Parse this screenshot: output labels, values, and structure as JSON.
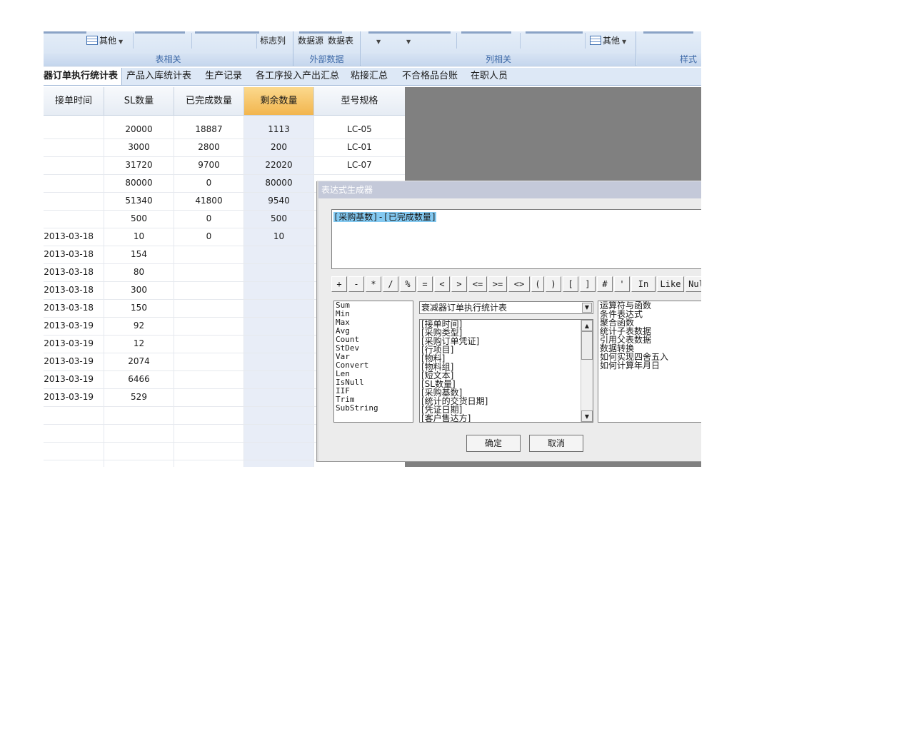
{
  "ribbon": {
    "groups": [
      {
        "title": "表相关",
        "buttons": [
          {
            "label": "其他",
            "icon": "table-icon"
          },
          {
            "label": "标志列"
          }
        ]
      },
      {
        "title": "外部数据",
        "buttons": [
          {
            "label": "数据源"
          },
          {
            "label": "数据表"
          }
        ]
      },
      {
        "title": "列相关",
        "buttons": [
          {
            "label": "其他",
            "icon": "table-icon"
          }
        ]
      },
      {
        "title": "样式"
      }
    ]
  },
  "tabs": [
    "器订单执行统计表",
    "产品入库统计表",
    "生产记录",
    "各工序投入产出汇总",
    "粘接汇总",
    "不合格品台账",
    "在职人员"
  ],
  "grid": {
    "columns": [
      "接单时间",
      "SL数量",
      "已完成数量",
      "剩余数量",
      "型号规格"
    ],
    "selected_column": "剩余数量",
    "rows": [
      [
        "",
        "20000",
        "18887",
        "1113",
        "LC-05"
      ],
      [
        "",
        "3000",
        "2800",
        "200",
        "LC-01"
      ],
      [
        "",
        "31720",
        "9700",
        "22020",
        "LC-07"
      ],
      [
        "",
        "80000",
        "0",
        "80000",
        ""
      ],
      [
        "",
        "51340",
        "41800",
        "9540",
        ""
      ],
      [
        "",
        "500",
        "0",
        "500",
        ""
      ],
      [
        "2013-03-18",
        "10",
        "0",
        "10",
        ""
      ],
      [
        "2013-03-18",
        "154",
        "",
        "",
        ""
      ],
      [
        "2013-03-18",
        "80",
        "",
        "",
        ""
      ],
      [
        "2013-03-18",
        "300",
        "",
        "",
        ""
      ],
      [
        "2013-03-18",
        "150",
        "",
        "",
        ""
      ],
      [
        "2013-03-19",
        "92",
        "",
        "",
        ""
      ],
      [
        "2013-03-19",
        "12",
        "",
        "",
        ""
      ],
      [
        "2013-03-19",
        "2074",
        "",
        "",
        ""
      ],
      [
        "2013-03-19",
        "6466",
        "",
        "",
        ""
      ],
      [
        "2013-03-19",
        "529",
        "",
        "",
        ""
      ],
      [
        "",
        "",
        "",
        "",
        ""
      ],
      [
        "",
        "",
        "",
        "",
        ""
      ],
      [
        "",
        "",
        "",
        "",
        ""
      ]
    ]
  },
  "dialog": {
    "title": "表达式生成器",
    "expression": "[采购基数]-[已完成数量]",
    "operators": [
      "+",
      "-",
      "*",
      "/",
      "%",
      "=",
      "<",
      ">",
      "<=",
      ">=",
      "<>",
      "(",
      ")",
      "[",
      "]",
      "#",
      "'",
      "In",
      "Like",
      "Nul"
    ],
    "functions": [
      "Sum",
      "Min",
      "Max",
      "Avg",
      "Count",
      "StDev",
      "Var",
      "Convert",
      "Len",
      "IsNull",
      "IIF",
      "Trim",
      "SubString"
    ],
    "table_select": "衰减器订单执行统计表",
    "fields": [
      "[接单时间]",
      "[采购类型]",
      "[采购订单凭证]",
      "[行项目]",
      "[物料]",
      "[物料组]",
      "[短文本]",
      "[SL数量]",
      "[采购基数]",
      "[统计的交货日期]",
      "[凭证日期]",
      "[客户售达方]"
    ],
    "help_items": [
      "运算符与函数",
      "条件表达式",
      "聚合函数",
      "统计子表数据",
      "引用父表数据",
      "数据转换",
      "如何实现四舍五入",
      "如何计算年月日"
    ],
    "ok_label": "确定",
    "cancel_label": "取消"
  },
  "colors": {
    "selected_header": "#f2b54e",
    "highlight": "#83c9f1",
    "dark_area": "#808080",
    "ribbon_title": "#3e6aa8"
  }
}
